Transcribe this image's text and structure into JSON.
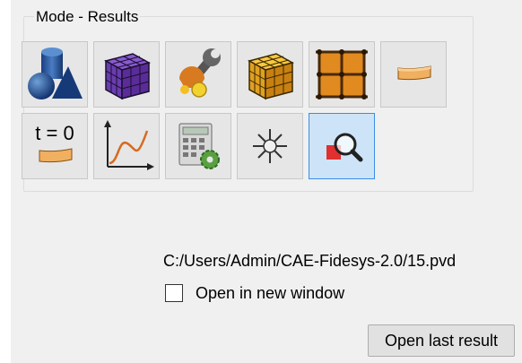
{
  "group": {
    "title": "Mode - Results"
  },
  "toolbar": {
    "buttons": [
      {
        "icon": "geometry-shapes-icon",
        "active": false
      },
      {
        "icon": "mesh-cube-icon",
        "active": false
      },
      {
        "icon": "settings-wrench-icon",
        "active": false
      },
      {
        "icon": "solid-cube-icon",
        "active": false
      },
      {
        "icon": "grid-frame-icon",
        "active": false
      },
      {
        "icon": "beam-icon",
        "active": false
      },
      {
        "icon": "initial-state-icon",
        "label": "t = 0",
        "active": false
      },
      {
        "icon": "plot-curve-icon",
        "active": false
      },
      {
        "icon": "calculator-gear-icon",
        "active": false
      },
      {
        "icon": "sparkle-icon",
        "active": false
      },
      {
        "icon": "results-inspect-icon",
        "active": true
      }
    ]
  },
  "result": {
    "path": "C:/Users/Admin/CAE-Fidesys-2.0/15.pvd",
    "open_new_window_label": "Open in new window",
    "open_new_window_checked": false,
    "open_last_label": "Open last result"
  },
  "colors": {
    "accent": "#3a8ee6",
    "panel": "#f0f0f0",
    "active_bg": "#cde3f7"
  }
}
